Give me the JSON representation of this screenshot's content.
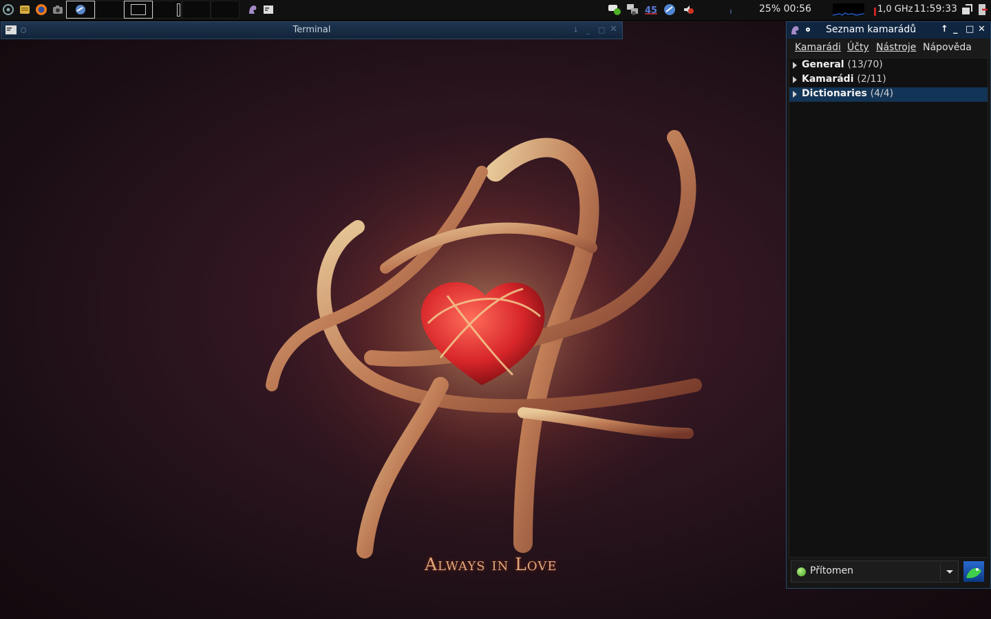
{
  "panel": {
    "launchers": [
      "menu-icon",
      "file-manager-icon",
      "firefox-icon",
      "screenshot-icon"
    ],
    "tray_icons": [
      "pidgin-tray-icon",
      "network-icon",
      "update-icon",
      "browser-tray-icon",
      "audio-icon"
    ],
    "battery": "25% 00:56",
    "cpu_freq": "1,0 GHz",
    "clock": "11:59:33"
  },
  "terminal": {
    "title": "Terminal"
  },
  "wallpaper": {
    "caption": "Always in Love"
  },
  "buddy_list": {
    "title": "Seznam kamarádů",
    "menu": [
      "Kamarádi",
      "Účty",
      "Nástroje",
      "Nápověda"
    ],
    "groups": [
      {
        "name": "General",
        "count": "(13/70)",
        "selected": false
      },
      {
        "name": "Kamarádi",
        "count": "(2/11)",
        "selected": false
      },
      {
        "name": "Dictionaries",
        "count": "(4/4)",
        "selected": true
      }
    ],
    "status": "Přítomen"
  },
  "colors": {
    "panel_bg": "#111111",
    "titlebar": "#0f2540",
    "selection": "#123456",
    "ribbon": "#e7b07a",
    "heart": "#d8262a"
  }
}
